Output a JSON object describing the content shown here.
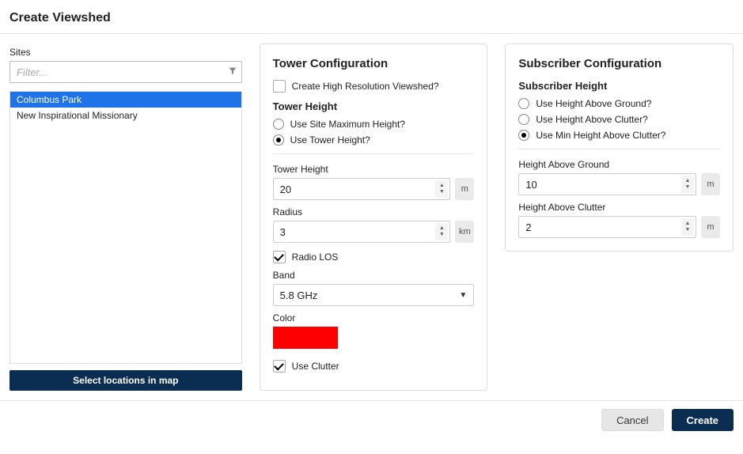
{
  "dialog": {
    "title": "Create Viewshed"
  },
  "sites": {
    "label": "Sites",
    "filter_placeholder": "Filter...",
    "items": [
      {
        "label": "Columbus Park",
        "selected": true
      },
      {
        "label": "New Inspirational Missionary",
        "selected": false
      }
    ],
    "map_button": "Select locations in map"
  },
  "tower": {
    "panel_title": "Tower Configuration",
    "high_res_label": "Create High Resolution Viewshed?",
    "high_res_checked": false,
    "height_section": "Tower Height",
    "radio_site_max": "Use Site Maximum Height?",
    "radio_tower_height": "Use Tower Height?",
    "radio_selected": "tower",
    "tower_height_label": "Tower Height",
    "tower_height_value": "20",
    "tower_height_unit": "m",
    "radius_label": "Radius",
    "radius_value": "3",
    "radius_unit": "km",
    "radio_los_label": "Radio LOS",
    "radio_los_checked": true,
    "band_label": "Band",
    "band_value": "5.8 GHz",
    "color_label": "Color",
    "color_value": "#ff0000",
    "use_clutter_label": "Use Clutter",
    "use_clutter_checked": true
  },
  "subscriber": {
    "panel_title": "Subscriber Configuration",
    "height_section": "Subscriber Height",
    "radio_above_ground": "Use Height Above Ground?",
    "radio_above_clutter": "Use Height Above Clutter?",
    "radio_min_above_clutter": "Use Min Height Above Clutter?",
    "radio_selected": "min_above_clutter",
    "hag_label": "Height Above Ground",
    "hag_value": "10",
    "hag_unit": "m",
    "hac_label": "Height Above Clutter",
    "hac_value": "2",
    "hac_unit": "m"
  },
  "footer": {
    "cancel": "Cancel",
    "create": "Create"
  }
}
